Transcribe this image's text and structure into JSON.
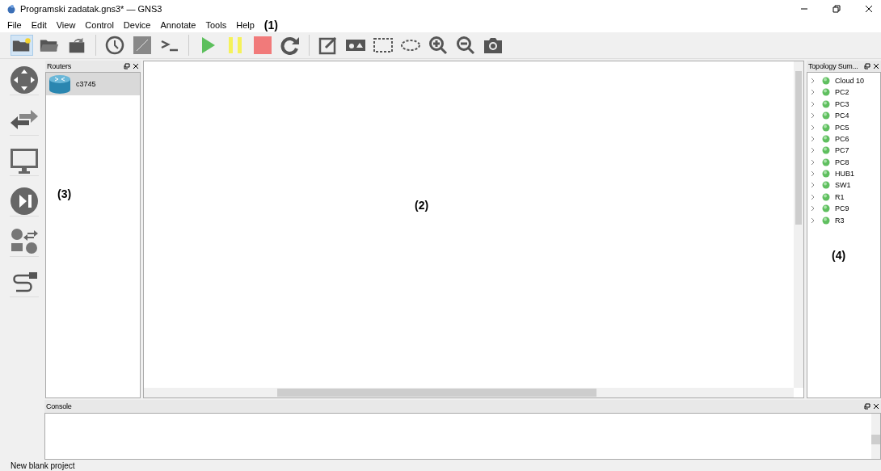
{
  "window": {
    "title": "Programski zadatak.gns3* — GNS3"
  },
  "menu": [
    "File",
    "Edit",
    "View",
    "Control",
    "Device",
    "Annotate",
    "Tools",
    "Help"
  ],
  "annotations": [
    "(1)",
    "(2)",
    "(3)",
    "(4)"
  ],
  "routers_panel": {
    "title": "Routers",
    "items": [
      {
        "label": "c3745",
        "selected": true
      }
    ]
  },
  "topology_panel": {
    "title": "Topology Sum...",
    "items": [
      {
        "label": "Cloud 10",
        "expanded": false
      },
      {
        "label": "PC2",
        "expanded": false
      },
      {
        "label": "PC3",
        "expanded": false
      },
      {
        "label": "PC4",
        "expanded": false
      },
      {
        "label": "PC5",
        "expanded": false
      },
      {
        "label": "PC6",
        "expanded": false
      },
      {
        "label": "PC7",
        "expanded": false
      },
      {
        "label": "PC8",
        "expanded": false
      },
      {
        "label": "HUB1",
        "expanded": false
      },
      {
        "label": "SW1",
        "expanded": false
      },
      {
        "label": "R1",
        "expanded": false
      },
      {
        "label": "PC9",
        "expanded": false
      },
      {
        "label": "R3",
        "expanded": false
      }
    ]
  },
  "console": {
    "title": "Console"
  },
  "status_bar": "New blank project"
}
